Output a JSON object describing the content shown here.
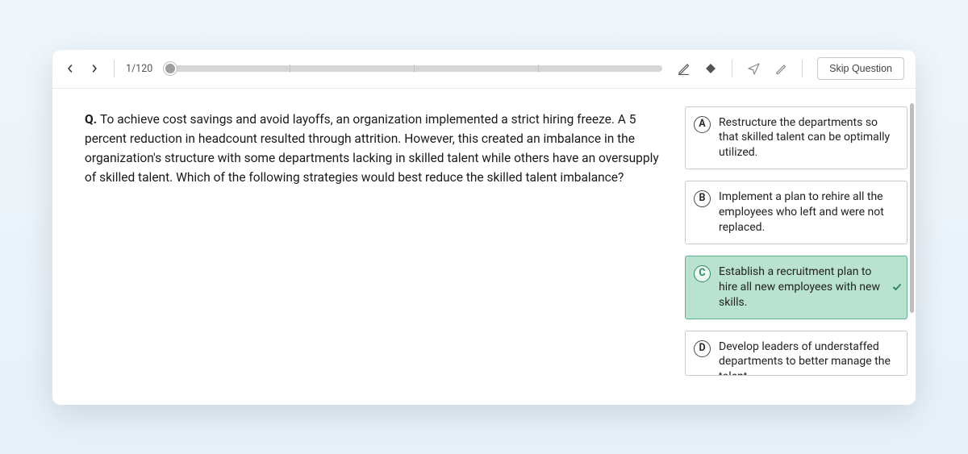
{
  "topbar": {
    "counter": "1/120",
    "skip_label": "Skip Question"
  },
  "question": {
    "prefix": "Q. ",
    "text": "To achieve cost savings and avoid layoffs, an organization implemented a strict hiring freeze. A 5 percent reduction in headcount resulted through attrition. However, this created an imbalance in the organization's structure with some departments lacking in skilled talent while others have an oversupply of skilled talent. Which of the following strategies would best reduce the skilled talent imbalance?"
  },
  "answers": [
    {
      "letter": "A",
      "text": "Restructure the departments so that skilled talent can be optimally utilized.",
      "selected": false
    },
    {
      "letter": "B",
      "text": "Implement a plan to rehire all the employees who left and were not replaced.",
      "selected": false
    },
    {
      "letter": "C",
      "text": "Establish a recruitment plan to hire all new employees with new skills.",
      "selected": true
    },
    {
      "letter": "D",
      "text": "Develop leaders of understaffed departments to better manage the talent",
      "selected": false
    }
  ],
  "icons": {
    "prev": "chevron-left",
    "next": "chevron-right",
    "pencil_underline": "pencil-underline",
    "diamond": "diamond",
    "paper_plane": "paper-plane",
    "edit": "edit-pencil",
    "check": "check"
  }
}
